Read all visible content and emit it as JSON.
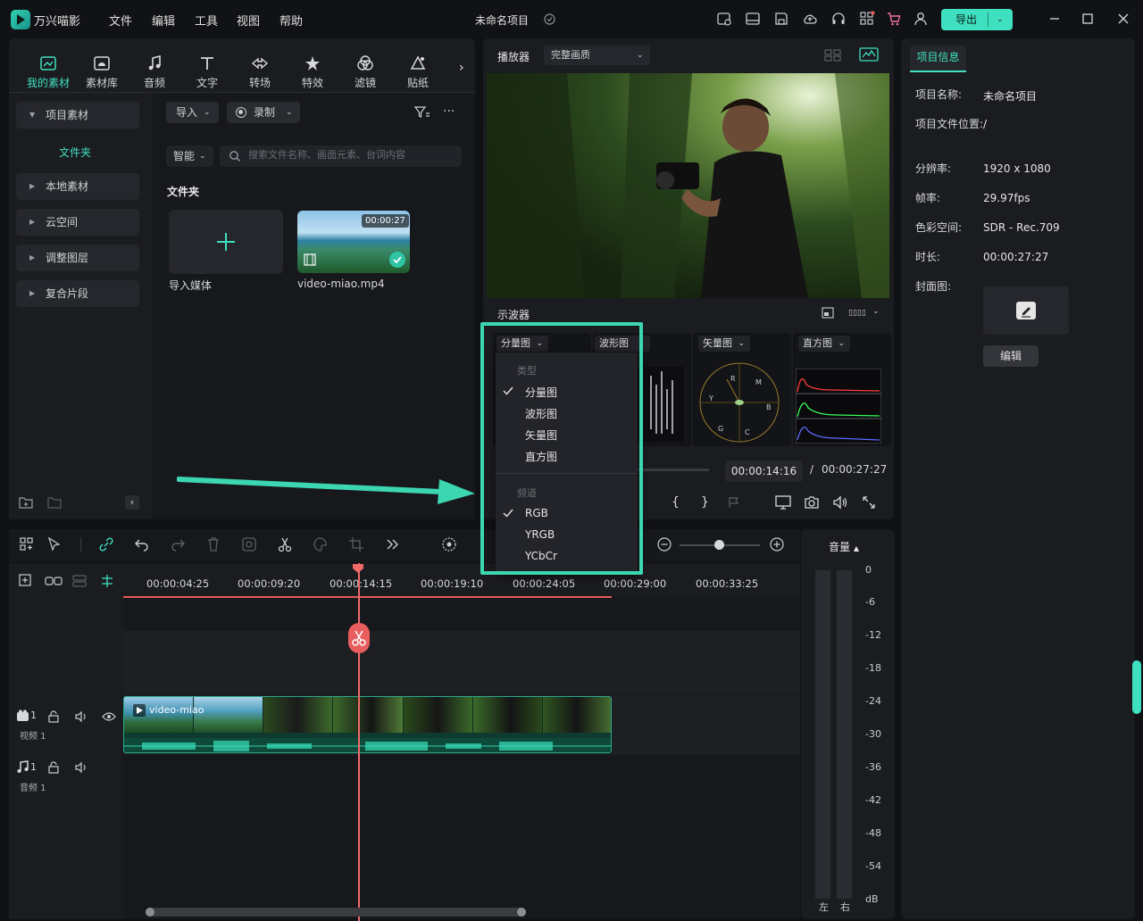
{
  "app": {
    "name": "万兴喵影",
    "project_title": "未命名项目"
  },
  "menu": [
    "文件",
    "编辑",
    "工具",
    "视图",
    "帮助"
  ],
  "export_label": "导出",
  "library_tabs": [
    "我的素材",
    "素材库",
    "音频",
    "文字",
    "转场",
    "特效",
    "滤镜",
    "贴纸"
  ],
  "tree": {
    "project_media": "项目素材",
    "folder": "文件夹",
    "items": [
      "本地素材",
      "云空间",
      "调整图层",
      "复合片段"
    ]
  },
  "assets": {
    "import_label": "导入",
    "record_label": "录制",
    "smart_label": "智能",
    "search_placeholder": "搜索文件名称、画面元素、台词内容",
    "folder_heading": "文件夹",
    "import_media": "导入媒体",
    "video_name": "video-miao.mp4",
    "video_duration": "00:00:27"
  },
  "player": {
    "label": "播放器",
    "quality": "完整画质",
    "scope_title": "示波器",
    "scopes": [
      "分量图",
      "波形图",
      "矢量图",
      "直方图"
    ],
    "current_time": "00:00:14:16",
    "separator": "/",
    "total_time": "00:00:27:27"
  },
  "scope_menu": {
    "type_header": "类型",
    "types": [
      "分量图",
      "波形图",
      "矢量图",
      "直方图"
    ],
    "selected_type": "分量图",
    "channel_header": "频道",
    "channels": [
      "RGB",
      "YRGB",
      "YCbCr"
    ],
    "selected_channel": "RGB"
  },
  "info": {
    "tab": "项目信息",
    "rows": [
      {
        "label": "项目名称:",
        "value": "未命名项目"
      },
      {
        "label": "项目文件位置:",
        "value": "/"
      },
      {
        "label": "分辨率:",
        "value": "1920 x 1080"
      },
      {
        "label": "帧率:",
        "value": "29.97fps"
      },
      {
        "label": "色彩空间:",
        "value": "SDR - Rec.709"
      },
      {
        "label": "时长:",
        "value": "00:00:27:27"
      },
      {
        "label": "封面图:",
        "value": ""
      }
    ],
    "edit_label": "编辑"
  },
  "timeline": {
    "ticks": [
      "00:00:04:25",
      "00:00:09:20",
      "00:00:14:15",
      "00:00:19:10",
      "00:00:24:05",
      "00:00:29:00",
      "00:00:33:25"
    ],
    "video_track": {
      "index": "1",
      "name": "视频 1"
    },
    "audio_track": {
      "index": "1",
      "name": "音频 1"
    },
    "clip_name": "video-miao"
  },
  "meter": {
    "title": "音量",
    "scale": [
      "0",
      "-6",
      "-12",
      "-18",
      "-24",
      "-30",
      "-36",
      "-42",
      "-48",
      "-54",
      "dB"
    ],
    "left": "左",
    "right": "右"
  },
  "colors": {
    "accent": "#3fe0c0",
    "playhead": "#f06a6a",
    "highlight": "#3cd6b0"
  }
}
